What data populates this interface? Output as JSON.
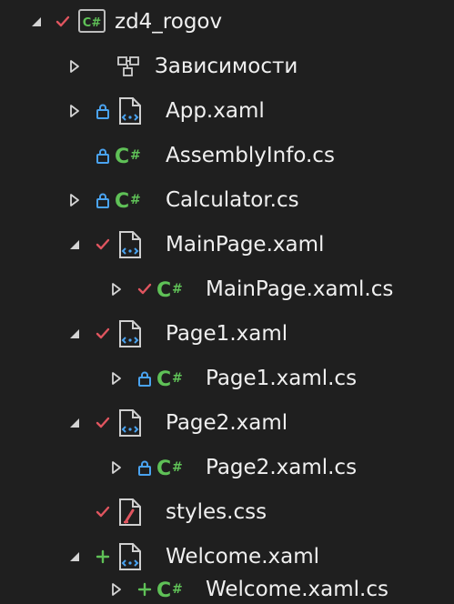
{
  "tree": {
    "rows": [
      {
        "label": "zd4_rogov",
        "icon": "csharp-project-icon",
        "status": "checkmark",
        "expander": "expanded"
      },
      {
        "label": "Зависимости",
        "icon": "dependencies-icon",
        "status": "none",
        "expander": "collapsed"
      },
      {
        "label": "App.xaml",
        "icon": "xaml-file-icon",
        "status": "lock",
        "expander": "collapsed"
      },
      {
        "label": "AssemblyInfo.cs",
        "icon": "csharp-file-icon",
        "status": "lock",
        "expander": "none"
      },
      {
        "label": "Calculator.cs",
        "icon": "csharp-file-icon",
        "status": "lock",
        "expander": "collapsed"
      },
      {
        "label": "MainPage.xaml",
        "icon": "xaml-file-icon",
        "status": "checkmark",
        "expander": "expanded"
      },
      {
        "label": "MainPage.xaml.cs",
        "icon": "csharp-file-icon",
        "status": "checkmark",
        "expander": "collapsed"
      },
      {
        "label": "Page1.xaml",
        "icon": "xaml-file-icon",
        "status": "checkmark",
        "expander": "expanded"
      },
      {
        "label": "Page1.xaml.cs",
        "icon": "csharp-file-icon",
        "status": "lock",
        "expander": "collapsed"
      },
      {
        "label": "Page2.xaml",
        "icon": "xaml-file-icon",
        "status": "checkmark",
        "expander": "expanded"
      },
      {
        "label": "Page2.xaml.cs",
        "icon": "csharp-file-icon",
        "status": "lock",
        "expander": "collapsed"
      },
      {
        "label": "styles.css",
        "icon": "css-file-icon",
        "status": "checkmark",
        "expander": "none"
      },
      {
        "label": "Welcome.xaml",
        "icon": "xaml-file-icon",
        "status": "plus",
        "expander": "expanded"
      },
      {
        "label": "Welcome.xaml.cs",
        "icon": "csharp-file-icon",
        "status": "plus",
        "expander": "collapsed"
      }
    ]
  },
  "colors": {
    "background": "#1f1f1f",
    "text": "#f0f0f0",
    "checkmark": "#e0555f",
    "lock": "#4aa3f0",
    "plus": "#5fc157",
    "csharp": "#5fc157",
    "expander": "#d4d4d4"
  }
}
